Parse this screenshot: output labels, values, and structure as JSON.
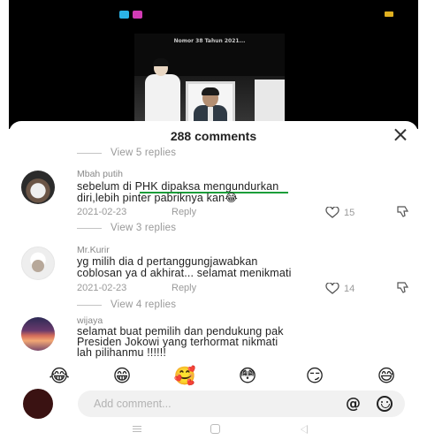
{
  "video": {
    "caption": "Nomor 38 Tahun 2021..."
  },
  "sheet": {
    "title": "288 comments"
  },
  "comments": [
    {
      "replies_above": "View 5 replies",
      "username": "Mbah putih",
      "text_line1": "sebelum di PHK dipaksa mengundurkan",
      "text_line2": "diri,lebih pinter pabriknya kan😂",
      "date": "2021-02-23",
      "reply_label": "Reply",
      "likes": "15",
      "replies_link": "View 3 replies"
    },
    {
      "username": "Mr.Kurir",
      "text_line1": "yg milih dia d pertanggungjawabkan",
      "text_line2": "coblosan ya d akhirat... selamat menikmati",
      "date": "2021-02-23",
      "reply_label": "Reply",
      "likes": "14",
      "replies_link": "View 4 replies"
    },
    {
      "username": "wijaya",
      "text_line1": "selamat buat pemilih dan pendukung pak",
      "text_line2": "Presiden Jokowi yang terhormat nikmati",
      "text_line3": "lah pilihanmu !!!!!!"
    }
  ],
  "emoji_bar": [
    "😂",
    "😁",
    "🥰",
    "😳",
    "😏",
    "😅"
  ],
  "composer": {
    "placeholder": "Add comment...",
    "at_symbol": "@"
  },
  "colors": {
    "highlight_underline": "#1b9e3a",
    "video_background": "#000000"
  }
}
